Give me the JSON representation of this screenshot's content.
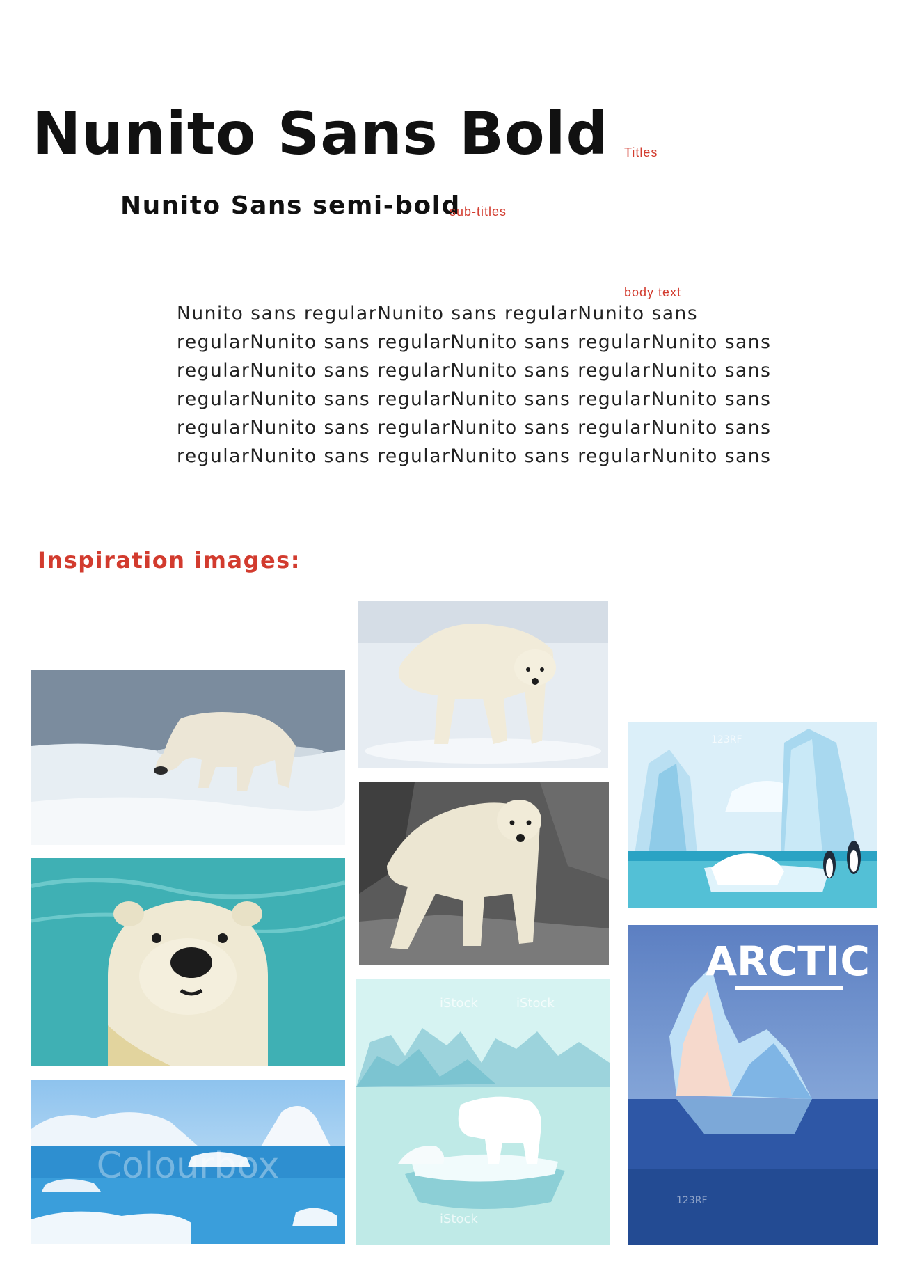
{
  "headings": {
    "title": "Nunito Sans Bold",
    "title_note": "Titles",
    "subtitle": "Nunito Sans semi-bold",
    "subtitle_note": "sub-titles"
  },
  "body": {
    "note": "body text",
    "lines": [
      "Nunito sans regularNunito sans regularNunito sans",
      "regularNunito sans regularNunito sans regularNunito sans",
      "regularNunito sans regularNunito sans regularNunito sans",
      "regularNunito sans regularNunito sans regularNunito sans",
      "regularNunito sans regularNunito sans regularNunito sans",
      "regularNunito sans regularNunito sans regularNunito sans"
    ]
  },
  "inspiration": {
    "heading": "Inspiration images:",
    "poster_text": "ARCTIC",
    "watermark_text": "Colourbox",
    "istock_text": "iStock",
    "rf_text": "123RF"
  },
  "colors": {
    "accent": "#d23b2e",
    "text": "#111111"
  }
}
